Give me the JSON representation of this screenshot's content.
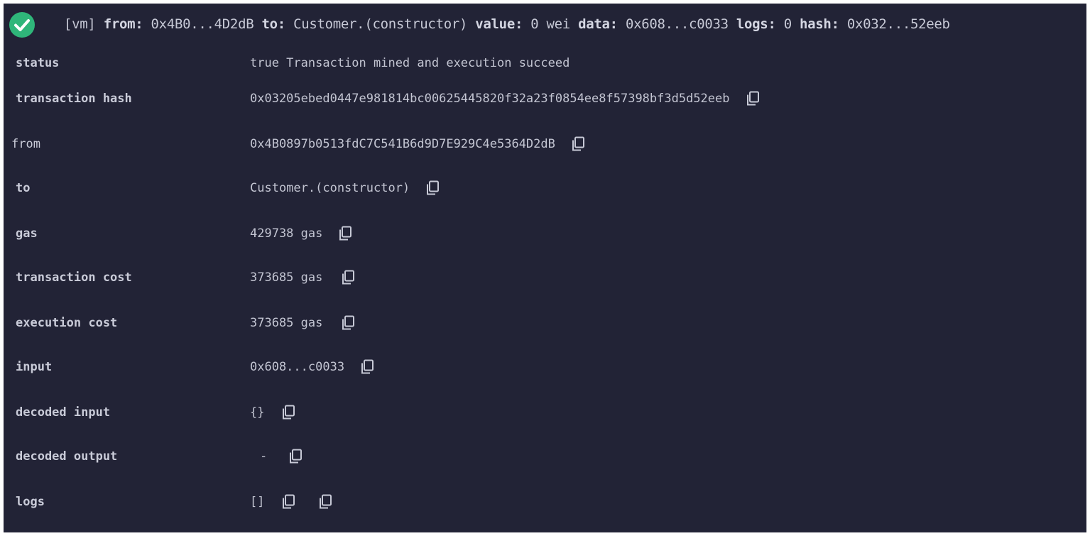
{
  "header": {
    "vm_tag": "[vm]",
    "from_label": "from:",
    "from_value": "0x4B0...4D2dB",
    "to_label": "to:",
    "to_value": "Customer.(constructor)",
    "value_label": "value:",
    "value_value": "0 wei",
    "data_label": "data:",
    "data_value": "0x608...c0033",
    "logs_label": "logs:",
    "logs_value": "0",
    "hash_label": "hash:",
    "hash_value": "0x032...52eeb"
  },
  "rows": {
    "status": {
      "key": "status",
      "value": "true Transaction mined and execution succeed"
    },
    "transaction_hash": {
      "key": "transaction hash",
      "value": "0x03205ebed0447e981814bc00625445820f32a23f0854ee8f57398bf3d5d52eeb"
    },
    "from": {
      "key": "from",
      "value": "0x4B0897b0513fdC7C541B6d9D7E929C4e5364D2dB"
    },
    "to": {
      "key": "to",
      "value": "Customer.(constructor)"
    },
    "gas": {
      "key": "gas",
      "value": "429738 gas"
    },
    "transaction_cost": {
      "key": "transaction cost",
      "value": "373685 gas"
    },
    "execution_cost": {
      "key": "execution cost",
      "value": "373685 gas"
    },
    "input": {
      "key": "input",
      "value": "0x608...c0033"
    },
    "decoded_input": {
      "key": "decoded input",
      "value": "{}"
    },
    "decoded_output": {
      "key": "decoded output",
      "value": "-"
    },
    "logs": {
      "key": "logs",
      "value": "[]"
    }
  },
  "icons": {
    "success": "check-circle-icon",
    "copy": "copy-icon"
  },
  "colors": {
    "background": "#222336",
    "success": "#2fb67a",
    "text": "#c7c9d6"
  }
}
